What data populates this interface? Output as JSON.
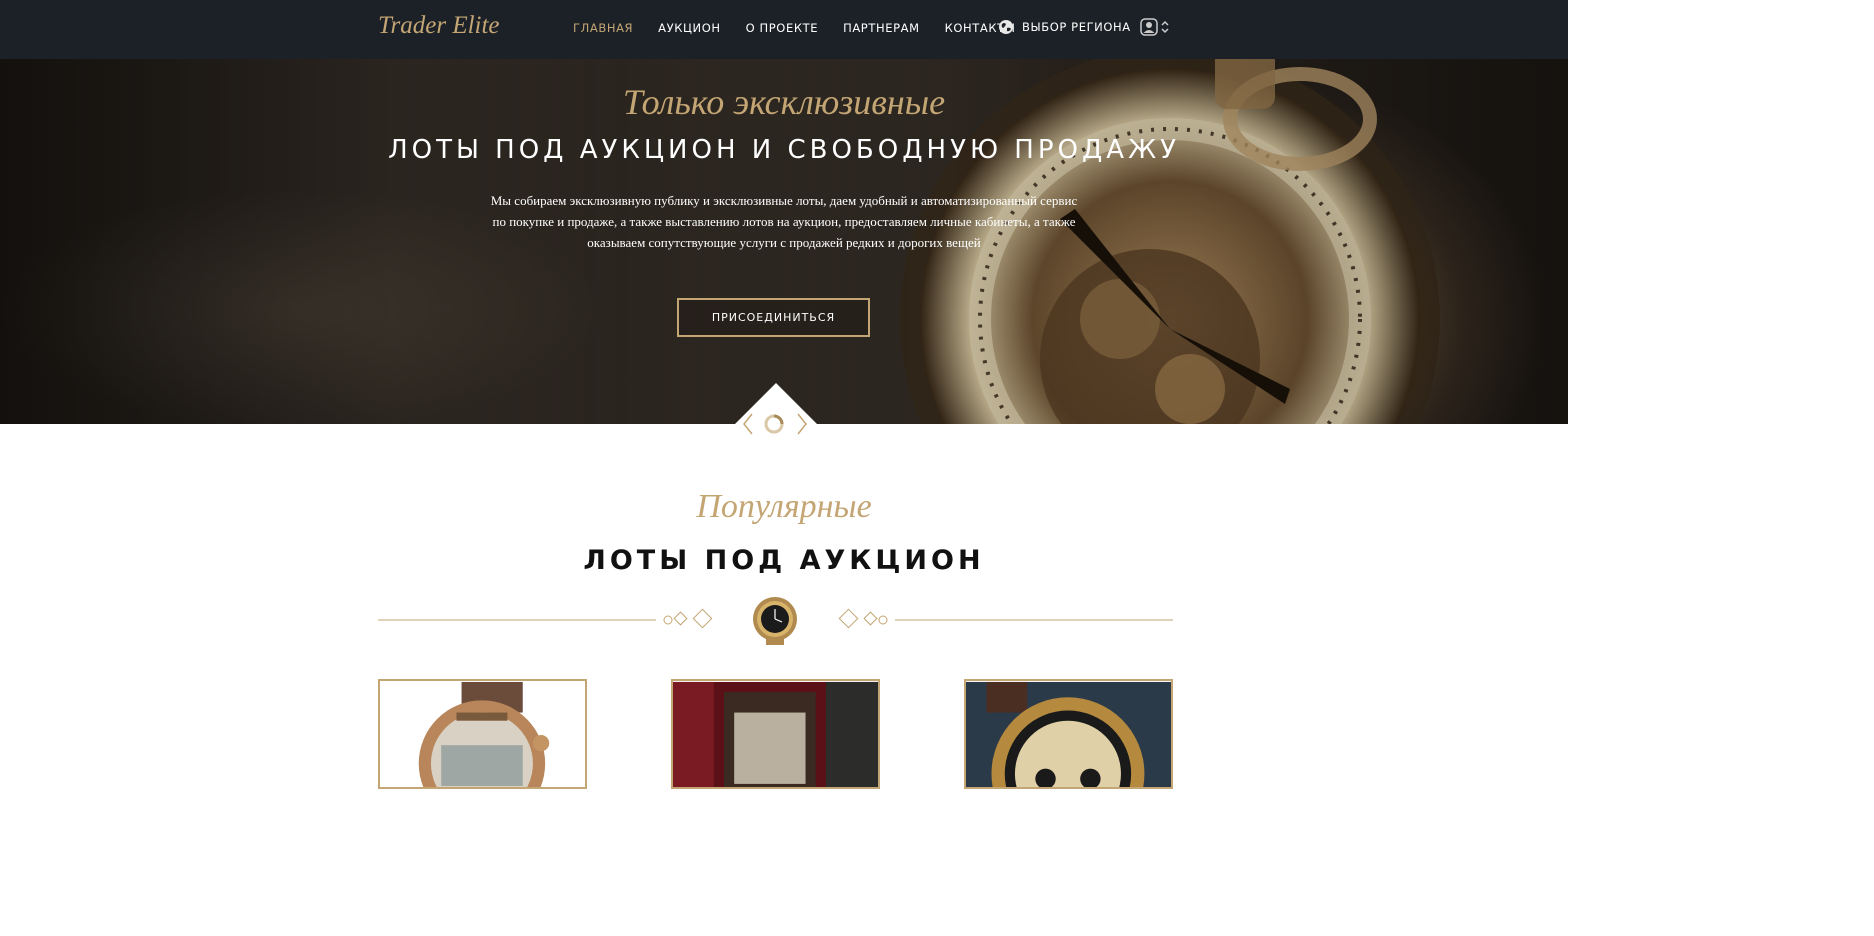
{
  "nav": {
    "logo": "Trader Elite",
    "items": [
      "ГЛАВНАЯ",
      "АУКЦИОН",
      "О ПРОЕКТЕ",
      "ПАРТНЕРАМ",
      "КОНТАКТЫ"
    ],
    "active_index": 0,
    "region_label": "ВЫБОР РЕГИОНА",
    "region_icon": "globe-icon",
    "user_icon": "user-icon"
  },
  "hero": {
    "script": "Только эксклюзивные",
    "title": "ЛОТЫ ПОД АУКЦИОН И СВОБОДНУЮ ПРОДАЖУ",
    "text": "Мы собираем эксклюзивную публику и эксклюзивные лоты, даем удобный и автоматизированный сервис по покупке и продаже, а также выставлению лотов на аукцион, предоставляем личные кабинеты, а также оказываем сопутствующие услуги с продажей редких и дорогих вещей",
    "button": "ПРИСОЕДИНИТЬСЯ"
  },
  "section": {
    "script": "Популярные",
    "title": "ЛОТЫ ПОД АУКЦИОН"
  },
  "colors": {
    "accent": "#c4a574",
    "nav_bg": "#1c2127"
  }
}
